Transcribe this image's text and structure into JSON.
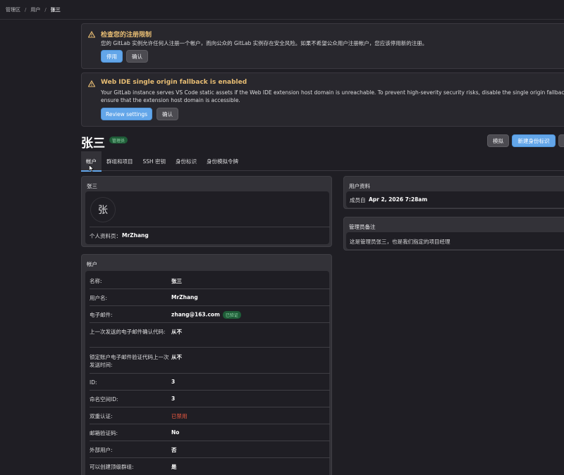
{
  "breadcrumb": {
    "items": [
      "管理区",
      "用户"
    ],
    "current": "张三"
  },
  "alerts": [
    {
      "title": "检查您的注册限制",
      "body": "您的 GitLab 实例允许任何人注册一个帐户，而向公众的 GitLab 实例存在安全风险。如果不希望公众用户注册帐户，您应该停用新的注册。",
      "primary": "停用",
      "secondary": "确认"
    },
    {
      "title": "Web IDE single origin fallback is enabled",
      "body": "Your GitLab instance serves VS Code static assets if the Web IDE extension host domain is unreachable. To prevent high-severity security risks, disable the single origin fallback and ensure that the extension host domain is accessible.",
      "primary": "Review settings",
      "secondary": "确认"
    }
  ],
  "user": {
    "name": "张三",
    "badge": "管理员",
    "avatar_text": "张"
  },
  "actions": {
    "impersonate": "模拟",
    "new_identity": "新建身份标识"
  },
  "tabs": [
    "帐户",
    "群组和项目",
    "SSH 密钥",
    "身份标识",
    "身份模拟令牌"
  ],
  "profile_panel": {
    "title": "张三",
    "profile_label": "个人资料页：",
    "profile_value": "MrZhang"
  },
  "account_panel": {
    "title": "帐户",
    "rows": [
      {
        "label": "名称:",
        "value": "张三"
      },
      {
        "label": "用户名:",
        "value": "MrZhang"
      },
      {
        "label": "电子邮件:",
        "value": "zhang@163.com",
        "badge": "已验证"
      },
      {
        "label": "上一次发送的电子邮件确认代码:",
        "value": "从不"
      },
      {
        "label": "锁定账户电子邮件验证代码上一次发送时间:",
        "value": "从不"
      },
      {
        "label": "ID:",
        "value": "3"
      },
      {
        "label": "命名空间ID:",
        "value": "3"
      },
      {
        "label": "双重认证:",
        "value": "已禁用"
      },
      {
        "label": "邮箱验证码:",
        "value": "No"
      },
      {
        "label": "外部用户:",
        "value": "否"
      },
      {
        "label": "可以创建顶级群组:",
        "value": "是"
      }
    ]
  },
  "user_info_panel": {
    "title": "用户资料",
    "member_since_label": "成员自",
    "member_since_value": "Apr 2, 2026 7:28am"
  },
  "admin_note_panel": {
    "title": "管理员备注",
    "note": "这是管理员张三，也是我们指定的项目经理"
  },
  "colors": {
    "warning": "#e9be74",
    "danger": "#ec5941",
    "accent": "#63a6e9",
    "success_bg": "#1f5d38"
  }
}
